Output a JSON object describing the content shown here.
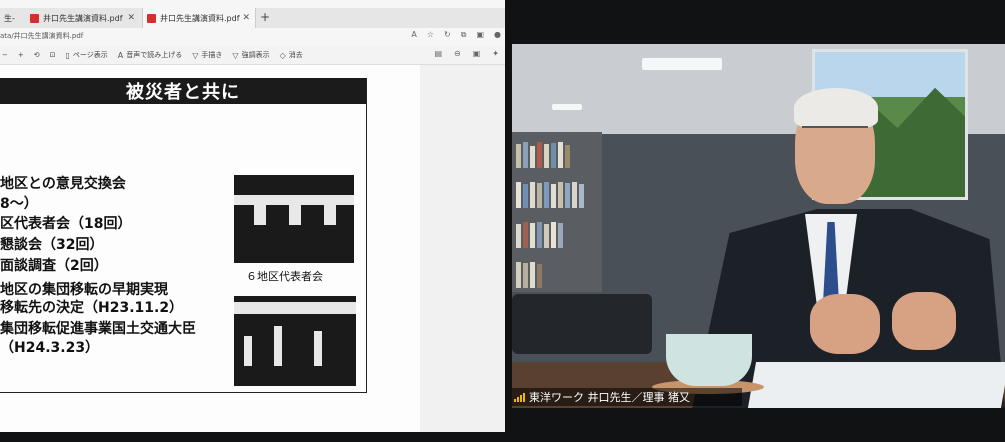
{
  "browser": {
    "tabs": [
      {
        "label": "生-",
        "active": false
      },
      {
        "label": "井口先生講演資料.pdf",
        "active": false
      },
      {
        "label": "井口先生講演資料.pdf",
        "active": true
      }
    ],
    "new_tab_label": "+",
    "address": "ata/井口先生講演資料.pdf"
  },
  "toolbar": {
    "page_view_label": "ページ表示",
    "read_aloud_label": "音声で読み上げる",
    "draw_label": "手描き",
    "highlight_label": "強調表示",
    "erase_label": "消去"
  },
  "slide": {
    "title": "被災者と共に",
    "lines": [
      "地区との意見交換会",
      "8～）",
      "区代表者会（18回）",
      "懇談会（32回）",
      "面談調査（2回）",
      "地区の集団移転の早期実現",
      "移転先の決定（H23.11.2）",
      "集団移転促進事業国土交通大臣",
      "（H24.3.23）"
    ],
    "photo_caption": "６地区代表者会"
  },
  "video": {
    "name_label": "東洋ワーク 井口先生／理事 猪又"
  }
}
